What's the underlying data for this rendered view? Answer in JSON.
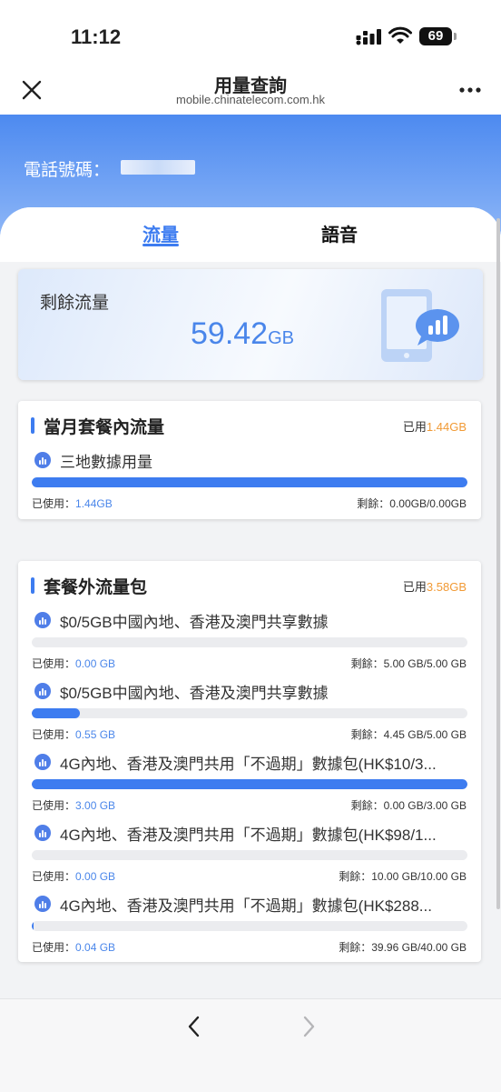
{
  "status": {
    "time": "11:12",
    "battery": "69"
  },
  "nav": {
    "title": "用量查詢",
    "url": "mobile.chinatelecom.com.hk"
  },
  "header": {
    "phone_label": "電話號碼："
  },
  "tabs": [
    {
      "label": "流量"
    },
    {
      "label": "語音"
    }
  ],
  "remaining": {
    "label": "剩餘流量",
    "value": "59.42",
    "unit": "GB"
  },
  "plan": {
    "title": "當月套餐內流量",
    "used_prefix": "已用",
    "used_value": "1.44GB",
    "items": [
      {
        "name": "三地數據用量",
        "used_label": "已使用：",
        "used": "1.44GB",
        "remain_label": "剩餘：",
        "remain": "0.00GB/0.00GB",
        "progress": 1.0
      }
    ]
  },
  "addon": {
    "title": "套餐外流量包",
    "used_prefix": "已用",
    "used_value": "3.58GB",
    "items": [
      {
        "name": "$0/5GB中國內地、香港及澳門共享數據",
        "used_label": "已使用：",
        "used": "0.00 GB",
        "remain_label": "剩餘：",
        "remain": "5.00 GB/5.00 GB",
        "progress": 0.0
      },
      {
        "name": "$0/5GB中國內地、香港及澳門共享數據",
        "used_label": "已使用：",
        "used": "0.55 GB",
        "remain_label": "剩餘：",
        "remain": "4.45 GB/5.00 GB",
        "progress": 0.11
      },
      {
        "name": "4G內地、香港及澳門共用「不過期」數據包(HK$10/3...",
        "used_label": "已使用：",
        "used": "3.00 GB",
        "remain_label": "剩餘：",
        "remain": "0.00 GB/3.00 GB",
        "progress": 1.0
      },
      {
        "name": "4G內地、香港及澳門共用「不過期」數據包(HK$98/1...",
        "used_label": "已使用：",
        "used": "0.00 GB",
        "remain_label": "剩餘：",
        "remain": "10.00 GB/10.00 GB",
        "progress": 0.0
      },
      {
        "name": "4G內地、香港及澳門共用「不過期」數據包(HK$288...",
        "used_label": "已使用：",
        "used": "0.04 GB",
        "remain_label": "剩餘：",
        "remain": "39.96 GB/40.00 GB",
        "progress": 0.001
      }
    ]
  },
  "colors": {
    "accent": "#3d7cf0",
    "orange": "#f19a35",
    "track": "#ebecef"
  },
  "icons": {
    "close": "close-icon",
    "more": "more-icon",
    "back": "chevron-left-icon",
    "forward": "chevron-right-icon",
    "usage": "signal-bars-icon"
  }
}
